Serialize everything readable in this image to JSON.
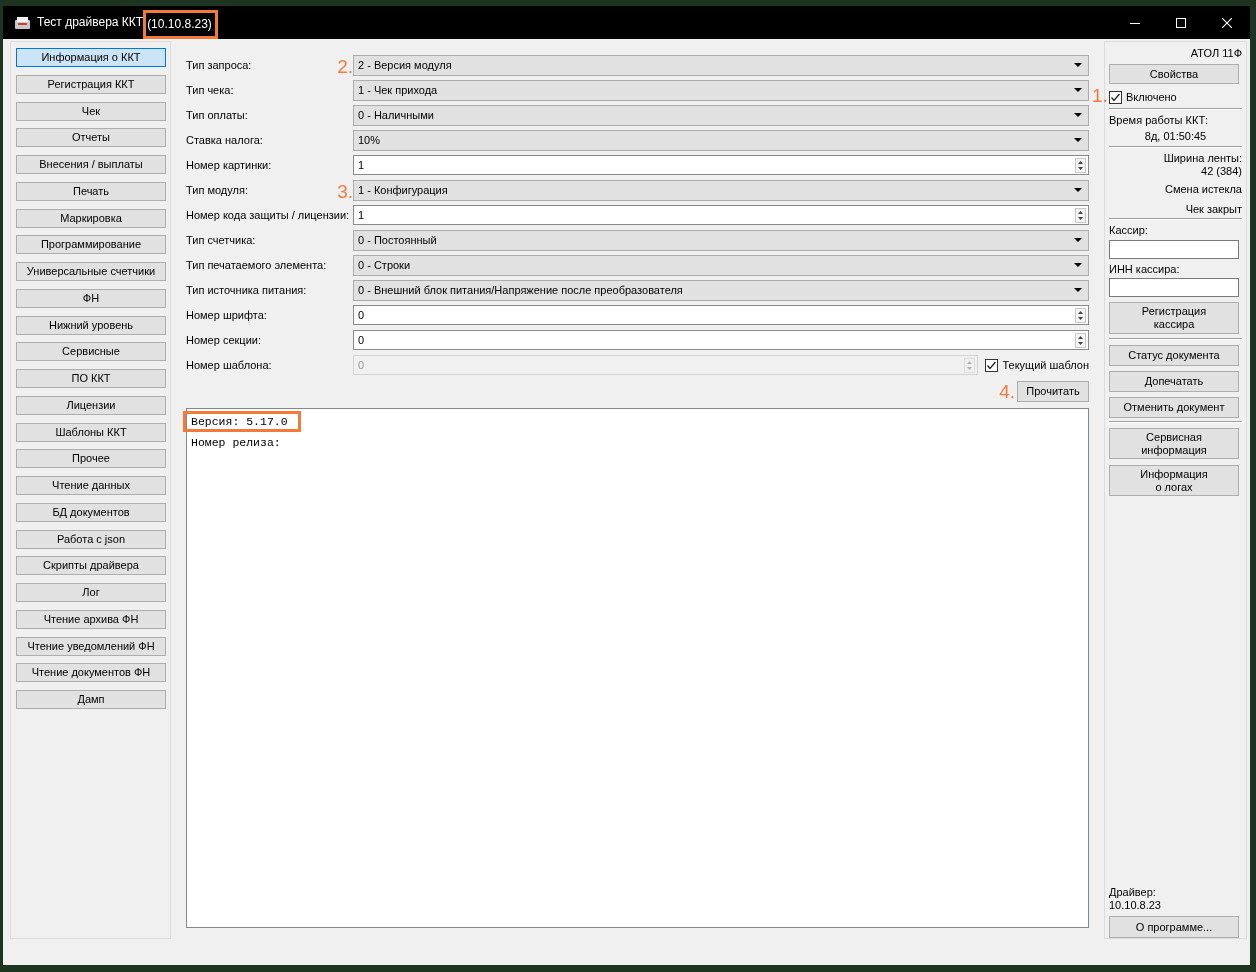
{
  "window": {
    "title": "Тест драйвера ККТ",
    "address": "(10.10.8.23)",
    "address_highlighted": true
  },
  "sidebar": {
    "items": [
      {
        "label": "Информация о ККТ",
        "selected": true
      },
      {
        "label": "Регистрация ККТ",
        "selected": false
      },
      {
        "label": "Чек",
        "selected": false
      },
      {
        "label": "Отчеты",
        "selected": false
      },
      {
        "label": "Внесения / выплаты",
        "selected": false
      },
      {
        "label": "Печать",
        "selected": false
      },
      {
        "label": "Маркировка",
        "selected": false
      },
      {
        "label": "Программирование",
        "selected": false
      },
      {
        "label": "Универсальные счетчики",
        "selected": false
      },
      {
        "label": "ФН",
        "selected": false
      },
      {
        "label": "Нижний уровень",
        "selected": false
      },
      {
        "label": "Сервисные",
        "selected": false
      },
      {
        "label": "ПО ККТ",
        "selected": false
      },
      {
        "label": "Лицензии",
        "selected": false
      },
      {
        "label": "Шаблоны ККТ",
        "selected": false
      },
      {
        "label": "Прочее",
        "selected": false
      },
      {
        "label": "Чтение данных",
        "selected": false
      },
      {
        "label": "БД документов",
        "selected": false
      },
      {
        "label": "Работа с json",
        "selected": false
      },
      {
        "label": "Скрипты драйвера",
        "selected": false
      },
      {
        "label": "Лог",
        "selected": false
      },
      {
        "label": "Чтение архива ФН",
        "selected": false
      },
      {
        "label": "Чтение уведомлений ФН",
        "selected": false
      },
      {
        "label": "Чтение документов ФН",
        "selected": false
      },
      {
        "label": "Дамп",
        "selected": false
      }
    ]
  },
  "form": {
    "fields": [
      {
        "label": "Тип запроса:",
        "kind": "combo",
        "value": "2 - Версия модуля",
        "disabled": false,
        "marker": "2."
      },
      {
        "label": "Тип чека:",
        "kind": "combo",
        "value": "1 - Чек прихода",
        "disabled": false
      },
      {
        "label": "Тип оплаты:",
        "kind": "combo",
        "value": "0 - Наличными",
        "disabled": false
      },
      {
        "label": "Ставка налога:",
        "kind": "combo",
        "value": "10%",
        "disabled": false
      },
      {
        "label": "Номер картинки:",
        "kind": "spin",
        "value": "1",
        "disabled": false
      },
      {
        "label": "Тип модуля:",
        "kind": "combo",
        "value": "1 - Конфигурация",
        "disabled": false,
        "marker": "3."
      },
      {
        "label": "Номер кода защиты / лицензии:",
        "kind": "spin",
        "value": "1",
        "disabled": false
      },
      {
        "label": "Тип счетчика:",
        "kind": "combo",
        "value": "0 - Постоянный",
        "disabled": false
      },
      {
        "label": "Тип печатаемого элемента:",
        "kind": "combo",
        "value": "0 - Строки",
        "disabled": false
      },
      {
        "label": "Тип источника питания:",
        "kind": "combo",
        "value": "0 - Внешний блок питания/Напряжение после преобразователя",
        "disabled": false
      },
      {
        "label": "Номер шрифта:",
        "kind": "spin",
        "value": "0",
        "disabled": false
      },
      {
        "label": "Номер секции:",
        "kind": "spin",
        "value": "0",
        "disabled": false
      },
      {
        "label": "Номер шаблона:",
        "kind": "spin",
        "value": "0",
        "disabled": true,
        "checkbox": {
          "label": "Текущий шаблон",
          "checked": true
        }
      }
    ],
    "read_button": {
      "label": "Прочитать",
      "marker": "4."
    },
    "output": {
      "lines": [
        {
          "text": "Версия: 5.17.0",
          "highlighted": true
        },
        {
          "text": "Номер релиза:",
          "highlighted": false
        }
      ]
    }
  },
  "device_panel": {
    "model": "АТОЛ 11Ф",
    "properties_button": "Свойства",
    "enabled": {
      "label": "Включено",
      "checked": true,
      "marker": "1."
    },
    "uptime": {
      "label": "Время работы ККТ:",
      "value": "8д, 01:50:45"
    },
    "tape_width": {
      "label": "Ширина ленты:",
      "value": "42 (384)"
    },
    "shift_status": "Смена истекла",
    "receipt_status": "Чек закрыт",
    "cashier_field": {
      "label": "Кассир:"
    },
    "cashier_inn_field": {
      "label": "ИНН кассира:"
    },
    "register_cashier_button": "Регистрация\nкассира",
    "document_buttons": [
      "Статус документа",
      "Допечатать",
      "Отменить документ"
    ],
    "info_buttons": [
      "Сервисная\nинформация",
      "Информация\nо логах"
    ],
    "driver": {
      "label": "Драйвер:",
      "version": "10.10.8.23"
    },
    "about_button": "О программе..."
  }
}
